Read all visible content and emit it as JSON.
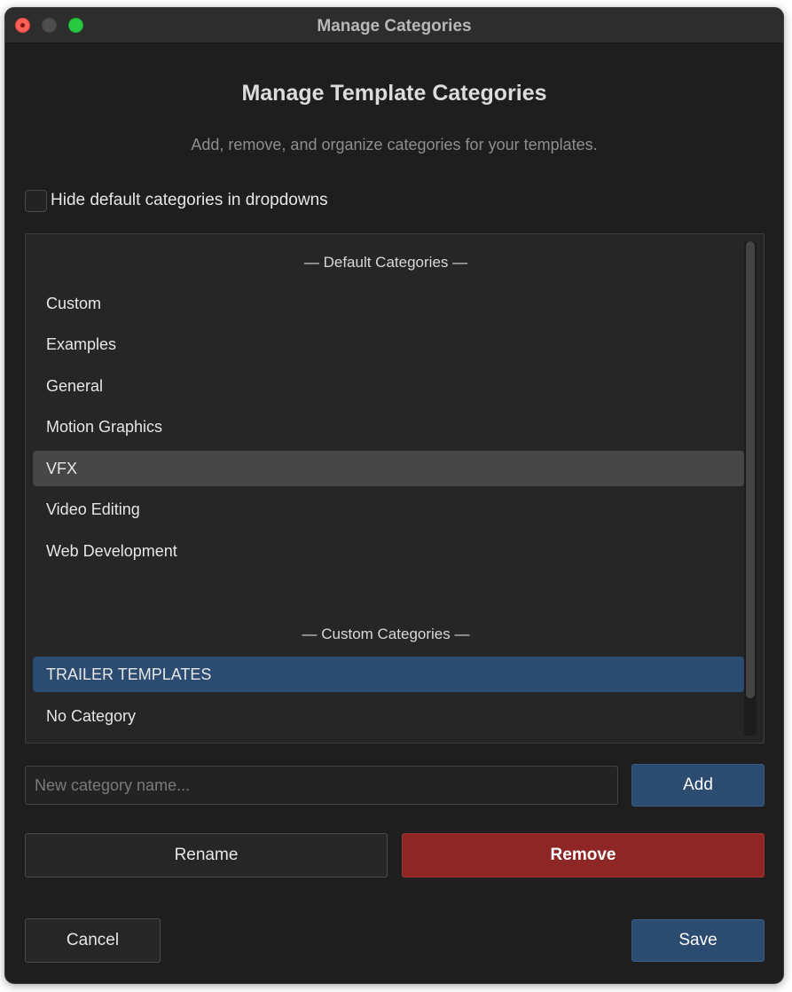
{
  "window": {
    "title": "Manage Categories"
  },
  "dialog": {
    "heading": "Manage Template Categories",
    "subtitle": "Add, remove, and organize categories for your templates.",
    "hide_defaults_label": "Hide default categories in dropdowns",
    "hide_defaults_checked": false
  },
  "list": {
    "default_header": "— Default Categories —",
    "default_items": [
      {
        "label": "Custom"
      },
      {
        "label": "Examples"
      },
      {
        "label": "General"
      },
      {
        "label": "Motion Graphics"
      },
      {
        "label": "VFX"
      },
      {
        "label": "Video Editing"
      },
      {
        "label": "Web Development"
      }
    ],
    "custom_header": "— Custom Categories —",
    "custom_items": [
      {
        "label": "TRAILER TEMPLATES"
      },
      {
        "label": "No Category"
      }
    ]
  },
  "new_category": {
    "value": "",
    "placeholder": "New category name..."
  },
  "buttons": {
    "add": "Add",
    "rename": "Rename",
    "remove": "Remove",
    "cancel": "Cancel",
    "save": "Save"
  },
  "colors": {
    "accent_blue": "#2c4b70",
    "danger_red": "#8e2626",
    "hover_gray": "#464646"
  }
}
